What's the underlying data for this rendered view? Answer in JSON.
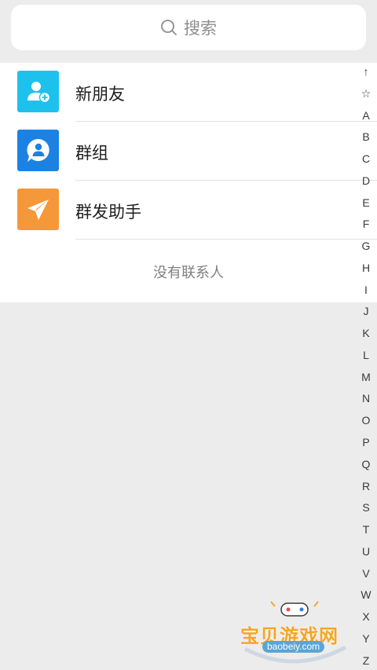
{
  "search": {
    "placeholder": "搜索"
  },
  "rows": [
    {
      "label": "新朋友",
      "icon": "add-user-icon",
      "color": "#1ec1ec"
    },
    {
      "label": "群组",
      "icon": "group-chat-icon",
      "color": "#1b82e3"
    },
    {
      "label": "群发助手",
      "icon": "paper-plane-icon",
      "color": "#f4983a"
    }
  ],
  "empty_text": "没有联系人",
  "index": [
    "↑",
    "☆",
    "A",
    "B",
    "C",
    "D",
    "E",
    "F",
    "G",
    "H",
    "I",
    "J",
    "K",
    "L",
    "M",
    "N",
    "O",
    "P",
    "Q",
    "R",
    "S",
    "T",
    "U",
    "V",
    "W",
    "X",
    "Y",
    "Z"
  ],
  "watermark": {
    "title": "宝贝游戏网",
    "url": "baobeiy.com"
  },
  "colors": {
    "background": "#ececec",
    "panel": "#ffffff"
  }
}
